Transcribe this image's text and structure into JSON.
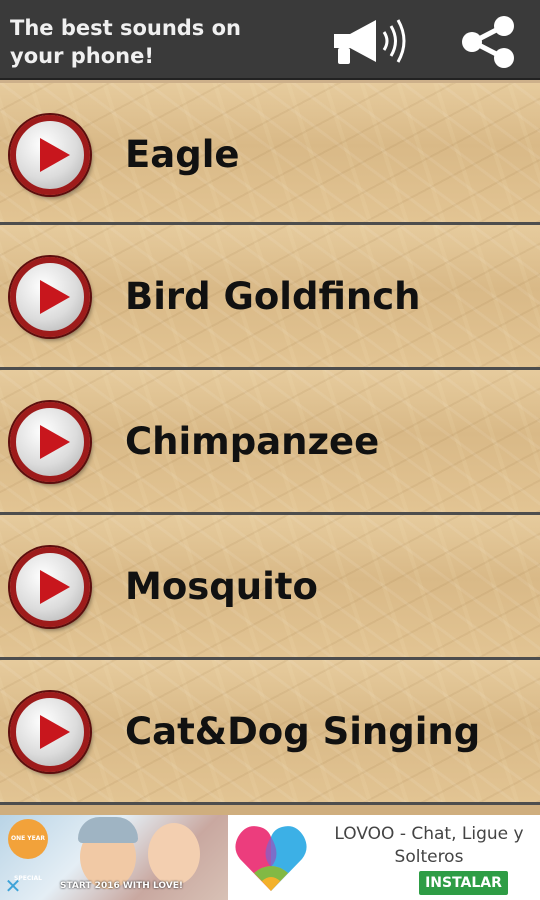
{
  "header": {
    "title": "The best sounds on your phone!",
    "megaphone_icon": "megaphone-icon",
    "share_icon": "share-icon"
  },
  "sounds": [
    {
      "label": "Eagle"
    },
    {
      "label": "Bird Goldfinch"
    },
    {
      "label": "Chimpanzee"
    },
    {
      "label": "Mosquito"
    },
    {
      "label": "Cat&Dog Singing"
    }
  ],
  "ad": {
    "promo_text": "START 2016 WITH LOVE!",
    "badge_text": "ONE YEAR SPECIAL",
    "title": "LOVOO - Chat, Ligue y Solteros",
    "install_label": "INSTALAR",
    "close_icon": "close-icon"
  },
  "colors": {
    "topbar": "#3a3a3a",
    "play_ring": "#9e1b1b",
    "play_triangle": "#c8161d",
    "install_button": "#2e9d45"
  }
}
